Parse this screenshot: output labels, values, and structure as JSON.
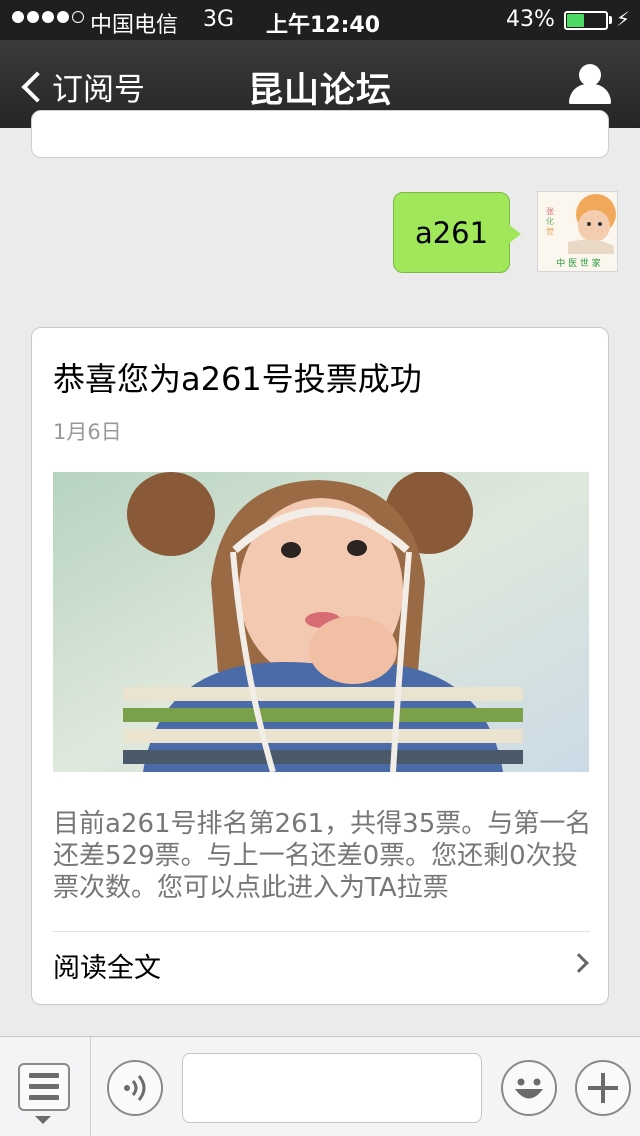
{
  "status_bar": {
    "carrier": "中国电信",
    "network": "3G",
    "time": "上午12:40",
    "battery_percent": "43%",
    "battery_level": 0.43
  },
  "nav": {
    "back_label": "订阅号",
    "title": "昆山论坛"
  },
  "messages": {
    "sent_text": "a261",
    "avatar_caption": "中 医 世 家"
  },
  "article": {
    "title": "恭喜您为a261号投票成功",
    "date": "1月6日",
    "summary": "目前a261号排名第261，共得35票。与第一名还差529票。与上一名还差0票。您还剩0次投票次数。您可以点此进入为TA拉票",
    "read_more": "阅读全文"
  },
  "input_bar": {
    "text_value": "",
    "icons": [
      "menu-list-icon",
      "voice-icon",
      "emoji-icon",
      "plus-icon"
    ]
  },
  "colors": {
    "bubble_green": "#a0e759",
    "battery_green": "#4cd964",
    "nav_background": "#2d2d2d"
  }
}
